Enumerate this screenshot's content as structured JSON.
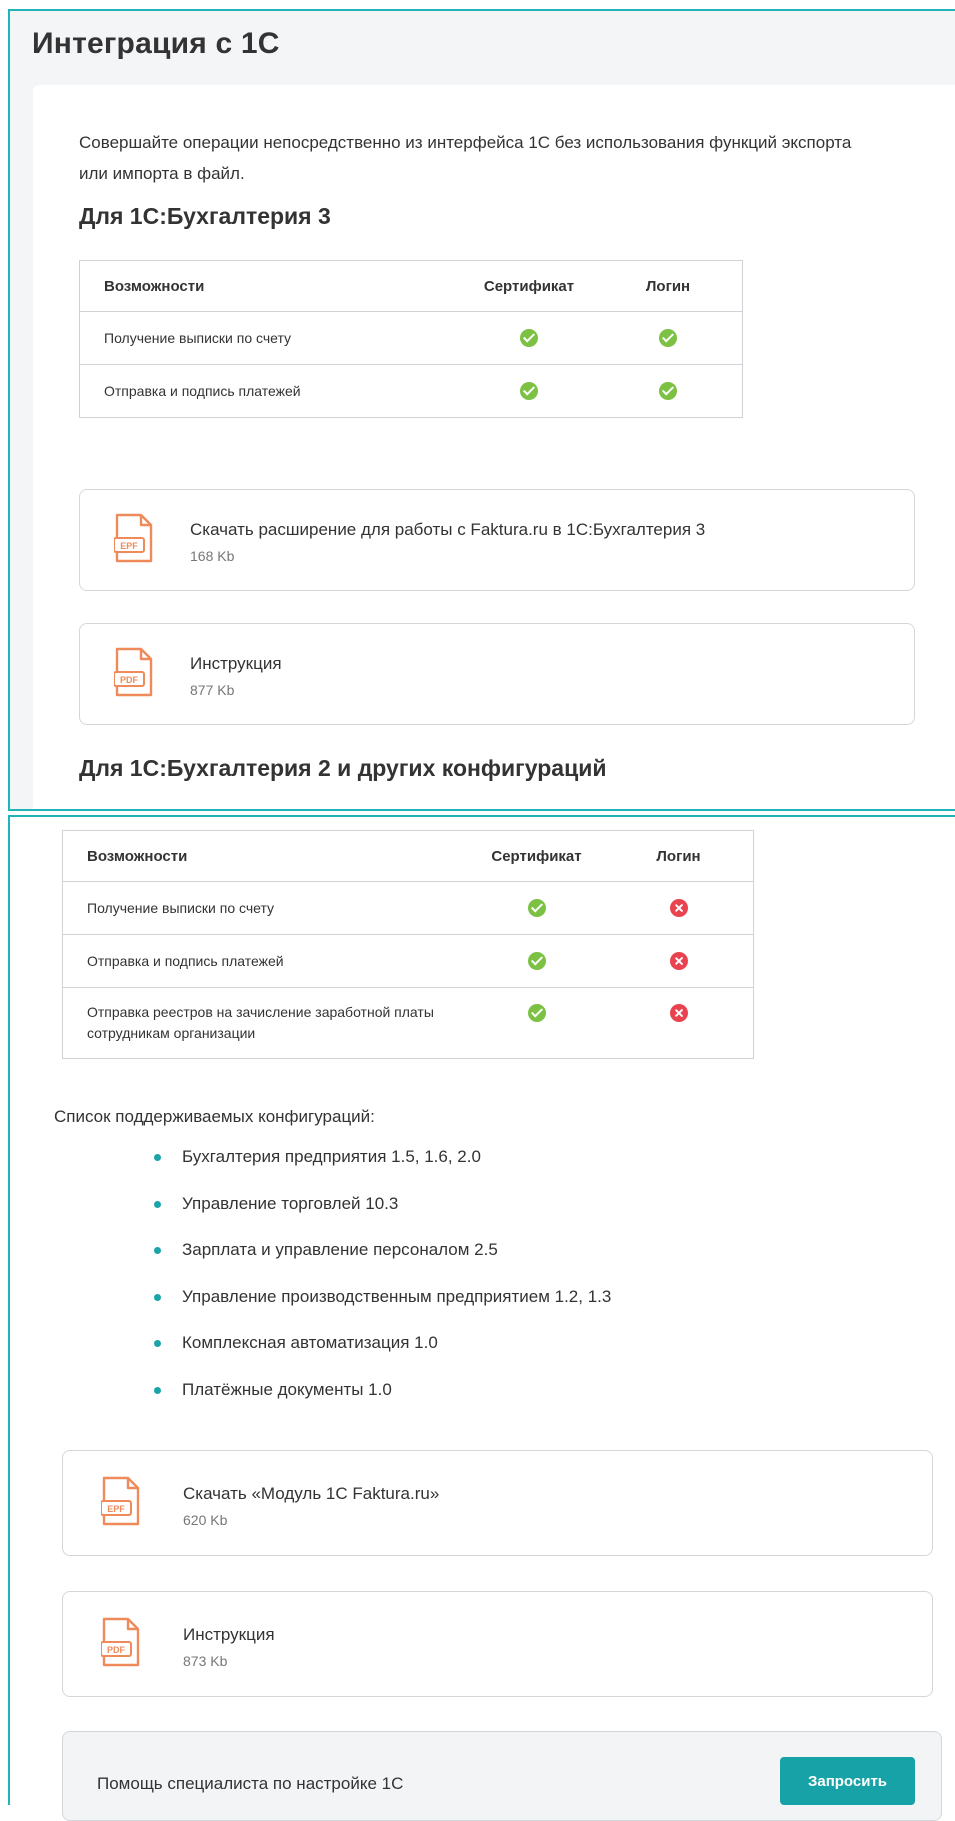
{
  "title": "Интеграция с 1С",
  "intro": "Совершайте операции непосредственно из интерфейса 1С без использования функций экспорта или импорта в файл.",
  "section1": {
    "heading": "Для 1С:Бухгалтерия 3",
    "table": {
      "headers": [
        "Возможности",
        "Сертификат",
        "Логин"
      ],
      "rows": [
        {
          "label": "Получение выписки по счету",
          "cert": "yes",
          "login": "yes"
        },
        {
          "label": "Отправка и подпись платежей",
          "cert": "yes",
          "login": "yes"
        }
      ]
    },
    "downloads": [
      {
        "icon": "epf-file-icon",
        "badge": "EPF",
        "title": "Скачать расширение для работы с Faktura.ru в 1С:Бухгалтерия 3",
        "size": "168 Kb"
      },
      {
        "icon": "pdf-file-icon",
        "badge": "PDF",
        "title": "Инструкция",
        "size": "877 Kb"
      }
    ]
  },
  "section2": {
    "heading": "Для 1С:Бухгалтерия 2 и других конфигураций",
    "table": {
      "headers": [
        "Возможности",
        "Сертификат",
        "Логин"
      ],
      "rows": [
        {
          "label": "Получение выписки по счету",
          "cert": "yes",
          "login": "no"
        },
        {
          "label": "Отправка и подпись платежей",
          "cert": "yes",
          "login": "no"
        },
        {
          "label": "Отправка реестров на зачисление заработной платы сотрудникам организации",
          "cert": "yes",
          "login": "no"
        }
      ]
    },
    "list_title": "Список поддерживаемых конфигураций:",
    "configs": [
      "Бухгалтерия предприятия 1.5, 1.6, 2.0",
      "Управление торговлей 10.3",
      "Зарплата и управление персоналом 2.5",
      "Управление производственным предприятием 1.2, 1.3",
      "Комплексная автоматизация 1.0",
      "Платёжные документы 1.0"
    ],
    "downloads": [
      {
        "icon": "epf-file-icon",
        "badge": "EPF",
        "title": "Скачать «Модуль 1С Faktura.ru»",
        "size": "620 Kb"
      },
      {
        "icon": "pdf-file-icon",
        "badge": "PDF",
        "title": "Инструкция",
        "size": "873 Kb"
      }
    ]
  },
  "help": {
    "text": "Помощь специалиста по настройке 1С",
    "button": "Запросить"
  },
  "colors": {
    "accent": "#16a2a6",
    "frame": "#22b3b8",
    "ok": "#7cc143",
    "no": "#e8434f",
    "file_icon": "#ef8a5a"
  }
}
